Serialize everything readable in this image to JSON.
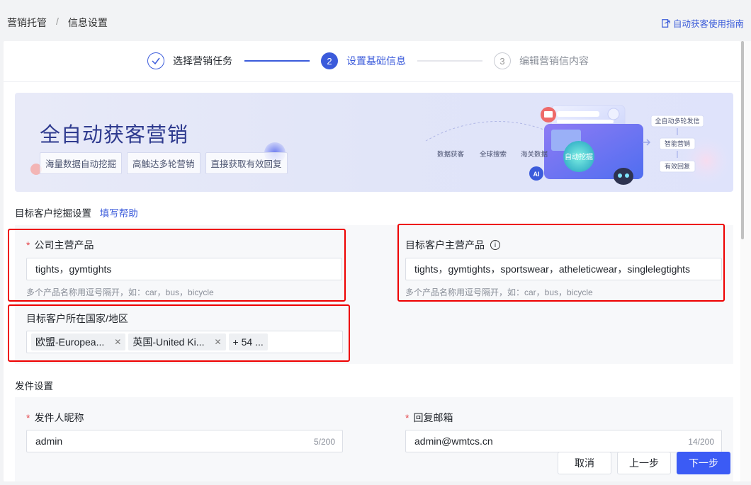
{
  "breadcrumb": {
    "root": "营销托管",
    "separator": "/",
    "current": "信息设置"
  },
  "guide_link": "自动获客使用指南",
  "steps": [
    {
      "index": "1",
      "label": "选择营销任务",
      "state": "done"
    },
    {
      "index": "2",
      "label": "设置基础信息",
      "state": "active"
    },
    {
      "index": "3",
      "label": "编辑营销信内容",
      "state": "todo"
    }
  ],
  "banner": {
    "title": "全自动获客营销",
    "tags": [
      "海量数据自动挖掘",
      "高触达多轮营销",
      "直接获取有效回复"
    ],
    "illustration": {
      "chips": [
        "数据获客",
        "全球搜索",
        "海关数据"
      ],
      "center": "自动挖掘",
      "ai_badge": "AI",
      "flow": [
        "全自动多轮发信",
        "智能营销",
        "有效回复"
      ]
    }
  },
  "section_mining": {
    "title": "目标客户挖掘设置",
    "help_link": "填写帮助"
  },
  "company_products": {
    "label": "公司主营产品",
    "required": true,
    "value": "tights，gymtights",
    "hint": "多个产品名称用逗号隔开，如：car，bus，bicycle"
  },
  "target_products": {
    "label": "目标客户主营产品",
    "info_icon": "info-icon",
    "value": "tights，gymtights，sportswear，atheleticwear，singlelegtights",
    "hint": "多个产品名称用逗号隔开，如：car，bus，bicycle"
  },
  "target_region": {
    "label": "目标客户所在国家/地区",
    "chips": [
      "欧盟-Europea...",
      "英国-United Ki..."
    ],
    "more": "+ 54 ..."
  },
  "section_sending": {
    "title": "发件设置"
  },
  "sender_name": {
    "label": "发件人昵称",
    "required": true,
    "value": "admin",
    "counter": "5/200"
  },
  "reply_email": {
    "label": "回复邮箱",
    "required": true,
    "value": "admin@wmtcs.cn",
    "counter": "14/200"
  },
  "footer": {
    "cancel": "取消",
    "prev": "上一步",
    "next": "下一步"
  },
  "colors": {
    "primary": "#3b5bf5",
    "highlight_box": "#ee0000",
    "link": "#3b5bdb"
  }
}
